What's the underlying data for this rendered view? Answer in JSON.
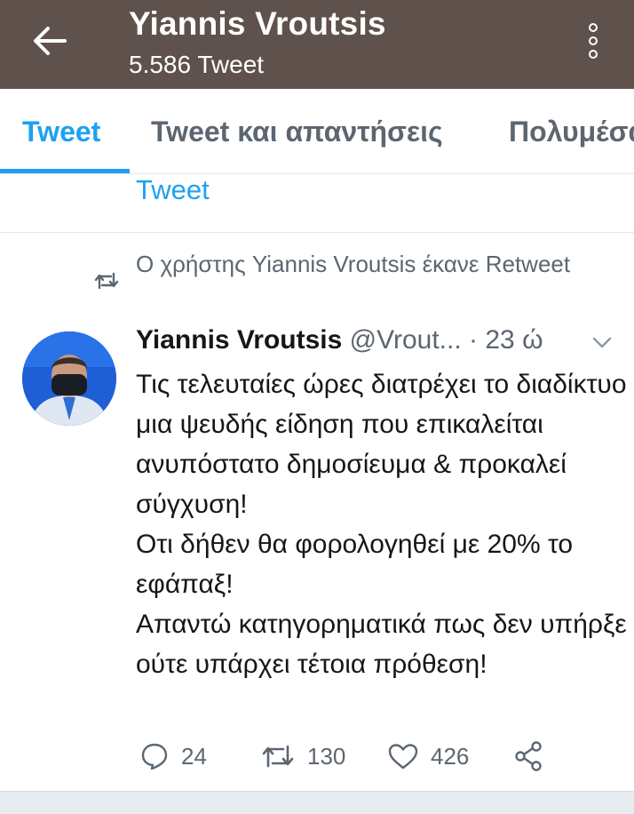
{
  "header": {
    "title": "Yiannis Vroutsis",
    "subtitle": "5.586 Tweet",
    "bg_color": "#5f514c",
    "back_icon": "arrow-left-icon",
    "menu_icon": "more-vertical-icon"
  },
  "tabs": [
    {
      "label": "Tweet",
      "active": true
    },
    {
      "label": "Tweet και απαντήσεις",
      "active": false
    },
    {
      "label": "Πολυμέσα",
      "active": false
    }
  ],
  "section_link": "Tweet",
  "retweet_notice": "Ο χρήστης Yiannis Vroutsis έκανε Retweet",
  "tweet": {
    "author_name": "Yiannis Vroutsis",
    "author_handle": "@Vrout...",
    "time": "· 23 ώ",
    "text": "Τις τελευταίες ώρες  διατρέχει το διαδίκτυο μια ψευδής είδηση που επικαλείται ανυπόστατο δημοσίευμα & προκαλεί σύγχυση!\nΟτι δήθεν θα φορολογηθεί με 20% το εφάπαξ!\nΑπαντώ κατηγορηματικά πως δεν υπήρξε ούτε υπάρχει τέτοια πρόθεση!",
    "replies": "24",
    "retweets": "130",
    "likes": "426"
  },
  "colors": {
    "accent": "#1da1f2",
    "secondary_text": "#5b6670",
    "divider": "#e1e8ed"
  }
}
